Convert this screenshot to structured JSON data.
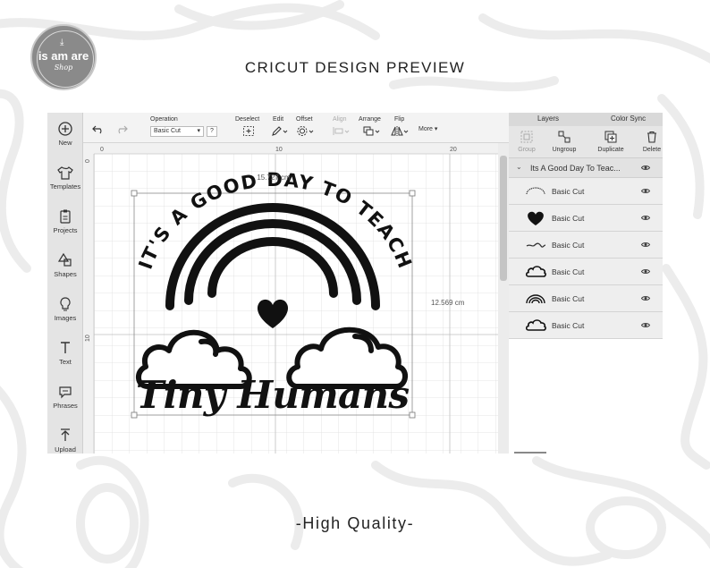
{
  "logo": {
    "brand": "is am are",
    "script": "Shop",
    "icon": "download-icon"
  },
  "titles": {
    "main": "CRICUT DESIGN PREVIEW",
    "footer": "-High Quality-"
  },
  "sidebar": {
    "items": [
      {
        "label": "New",
        "icon": "plus-circle-icon"
      },
      {
        "label": "Templates",
        "icon": "tshirt-icon"
      },
      {
        "label": "Projects",
        "icon": "clipboard-icon"
      },
      {
        "label": "Shapes",
        "icon": "shapes-icon"
      },
      {
        "label": "Images",
        "icon": "lightbulb-icon"
      },
      {
        "label": "Text",
        "icon": "text-t-icon"
      },
      {
        "label": "Phrases",
        "icon": "speech-bubble-icon"
      },
      {
        "label": "Upload",
        "icon": "upload-icon"
      }
    ]
  },
  "toolbar": {
    "operation_label": "Operation",
    "operation_value": "Basic Cut",
    "help": "?",
    "deselect": "Deselect",
    "edit": "Edit",
    "offset": "Offset",
    "align": "Align",
    "arrange": "Arrange",
    "flip": "Flip",
    "more": "More"
  },
  "canvas": {
    "ruler_top": [
      "0",
      "10",
      "20"
    ],
    "ruler_left": [
      "0",
      "10"
    ],
    "width_label": "15.727 cm",
    "height_label": "12.569 cm",
    "design": {
      "arc_text": "IT'S A GOOD DAY TO TEACH",
      "script_text": "Tiny Humans"
    }
  },
  "layers_panel": {
    "tabs": {
      "layers": "Layers",
      "color_sync": "Color Sync"
    },
    "actions": {
      "group": "Group",
      "ungroup": "Ungroup",
      "duplicate": "Duplicate",
      "delete": "Delete"
    },
    "group_name": "Its A Good Day To Teac...",
    "rows": [
      {
        "label": "Basic Cut",
        "thumb": "arc-text-thumb"
      },
      {
        "label": "Basic Cut",
        "thumb": "heart-thumb"
      },
      {
        "label": "Basic Cut",
        "thumb": "script-text-thumb"
      },
      {
        "label": "Basic Cut",
        "thumb": "cloud-thumb"
      },
      {
        "label": "Basic Cut",
        "thumb": "rainbow-thumb"
      },
      {
        "label": "Basic Cut",
        "thumb": "cloud-thumb"
      }
    ]
  },
  "colors": {
    "ink": "#111111",
    "sidebar_bg": "#e4e4e4",
    "panel_bg": "#f2f2f2",
    "grid_line": "#d9d9d9",
    "selection": "#8a8a8a"
  }
}
